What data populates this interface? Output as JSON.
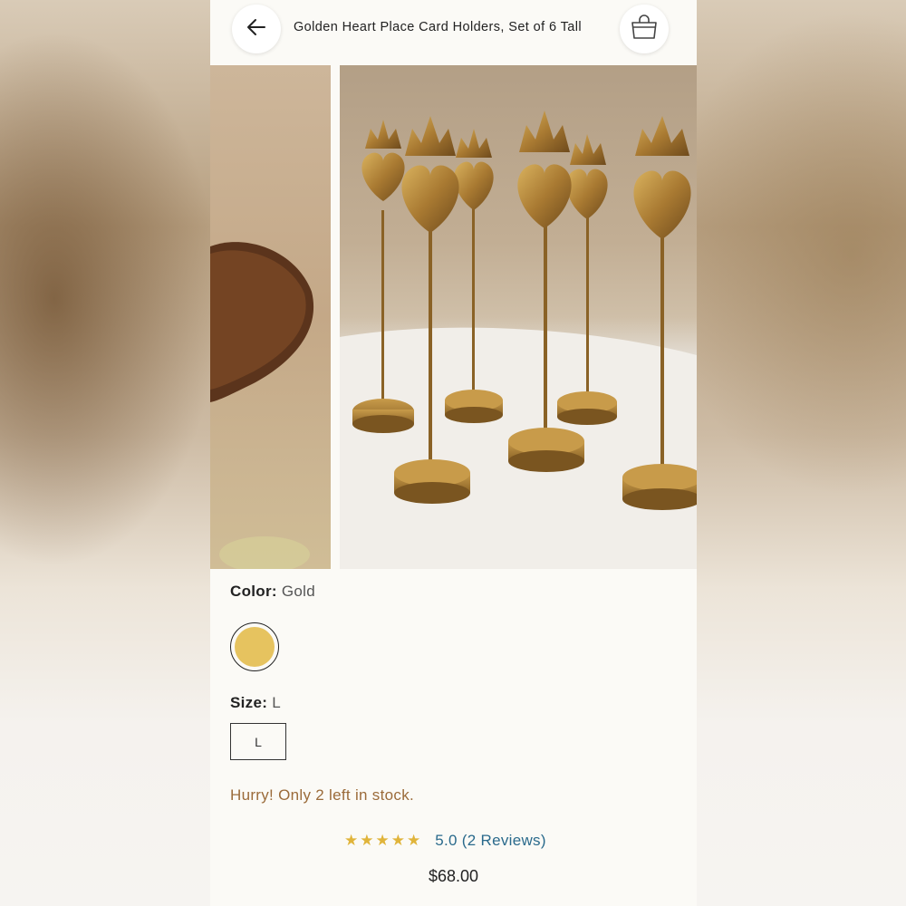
{
  "header": {
    "title": "Golden Heart Place Card Holders, Set of 6 Tall",
    "back_icon": "arrow-left-icon",
    "bag_icon": "shopping-bag-icon"
  },
  "gallery": {
    "images": [
      "product-image-detail",
      "product-image-main"
    ]
  },
  "options": {
    "color_label": "Color:",
    "color_value": "Gold",
    "color_swatch": "#e6c35f",
    "size_label": "Size:",
    "size_value": "L",
    "size_option": "L"
  },
  "stock_message": "Hurry! Only 2 left in stock.",
  "rating": {
    "stars": "★★★★★",
    "value": 5.0,
    "text": "5.0 (2 Reviews)"
  },
  "price": "$68.00",
  "colors": {
    "accent_gold": "#e0b43a",
    "stock_brown": "#9b6b3a",
    "review_link": "#2a6a8c"
  }
}
